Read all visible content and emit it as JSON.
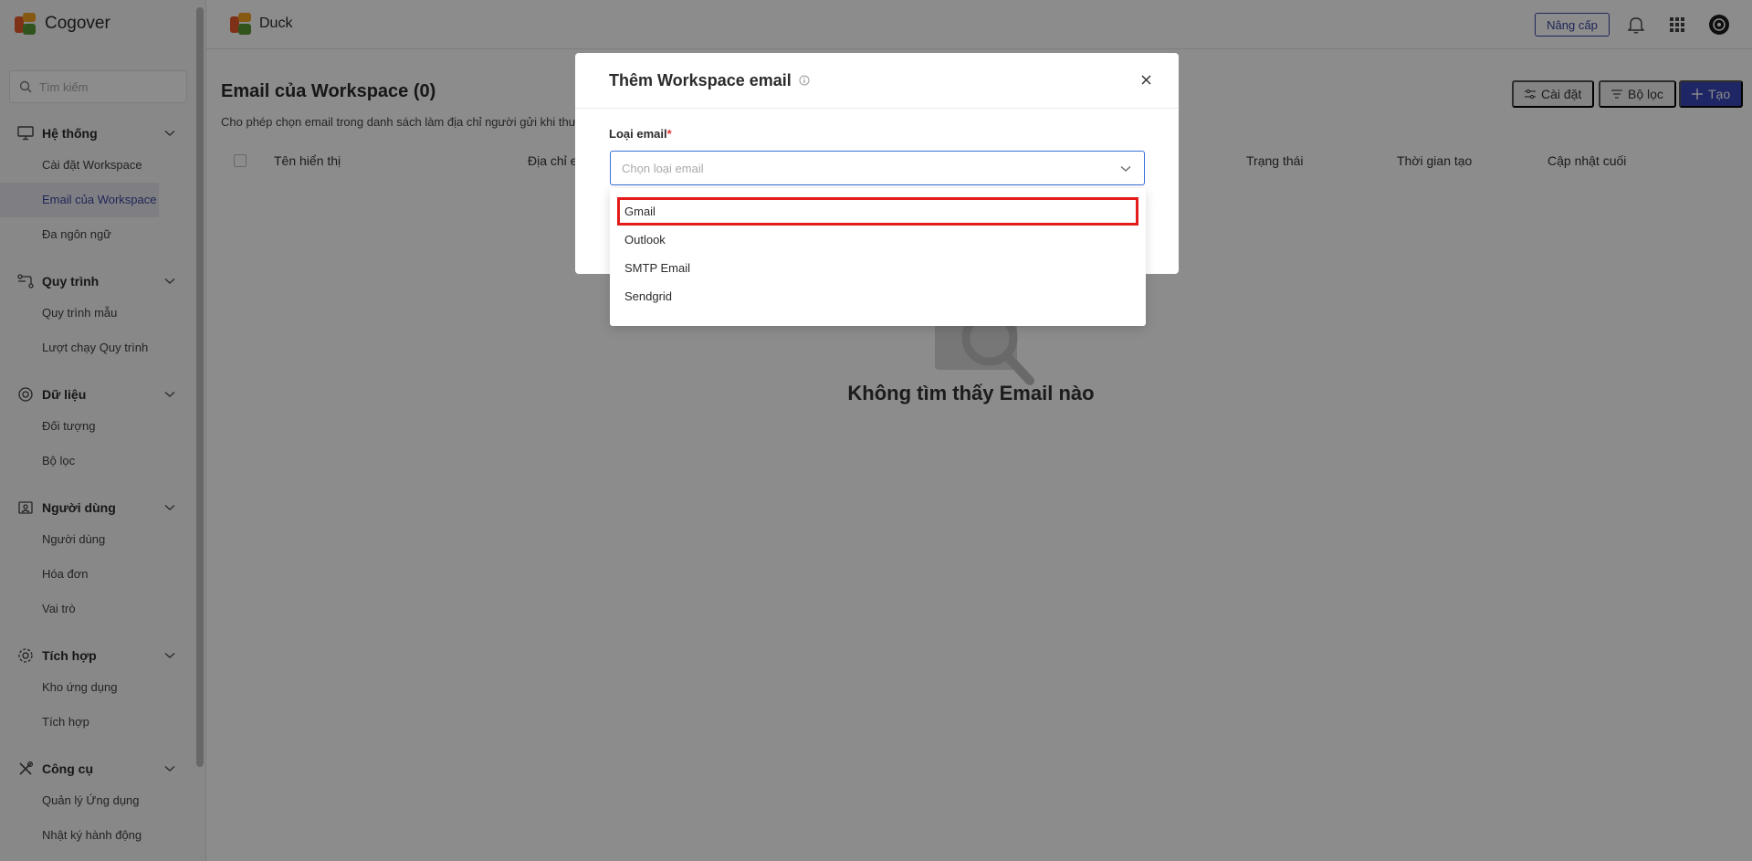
{
  "sidebar": {
    "brand": "Cogover",
    "search_placeholder": "Tìm kiếm",
    "groups": [
      {
        "label": "Hệ thống",
        "icon": "monitor-icon",
        "items": [
          "Cài đặt Workspace",
          "Email của Workspace",
          "Đa ngôn ngữ"
        ]
      },
      {
        "label": "Quy trình",
        "icon": "workflow-icon",
        "items": [
          "Quy trình mẫu",
          "Lượt chạy Quy trình"
        ]
      },
      {
        "label": "Dữ liệu",
        "icon": "data-icon",
        "items": [
          "Đối tượng",
          "Bộ lọc"
        ]
      },
      {
        "label": "Người dùng",
        "icon": "users-icon",
        "items": [
          "Người dùng",
          "Hóa đơn",
          "Vai trò"
        ]
      },
      {
        "label": "Tích hợp",
        "icon": "integration-icon",
        "items": [
          "Kho ứng dụng",
          "Tích hợp"
        ]
      },
      {
        "label": "Công cụ",
        "icon": "tools-icon",
        "items": [
          "Quản lý Ứng dụng",
          "Nhật ký hành động"
        ]
      }
    ],
    "active_item": "Email của Workspace"
  },
  "topbar": {
    "workspace_name": "Duck",
    "upgrade_label": "Nâng cấp",
    "icons": [
      "bell-icon",
      "apps-grid-icon",
      "avatar"
    ]
  },
  "main": {
    "title": "Email của Workspace (0)",
    "description": "Cho phép chọn email trong danh sách làm địa chỉ người gửi khi thư",
    "actions": {
      "settings": "Cài đặt",
      "filter": "Bộ lọc",
      "create": "Tạo"
    },
    "columns": [
      "Tên hiển thị",
      "Địa chỉ e",
      "Trạng thái",
      "Thời gian tạo",
      "Cập nhật cuối"
    ],
    "empty_text": "Không tìm thấy Email nào"
  },
  "modal": {
    "title": "Thêm Workspace email",
    "field_label": "Loại email",
    "required_mark": "*",
    "select_placeholder": "Chọn loại email",
    "options": [
      "Gmail",
      "Outlook",
      "SMTP Email",
      "Sendgrid"
    ],
    "highlighted_option": "Gmail"
  },
  "colors": {
    "accent": "#3a46b8",
    "highlight": "#e31b1b",
    "select_border": "#3a6fd8"
  }
}
